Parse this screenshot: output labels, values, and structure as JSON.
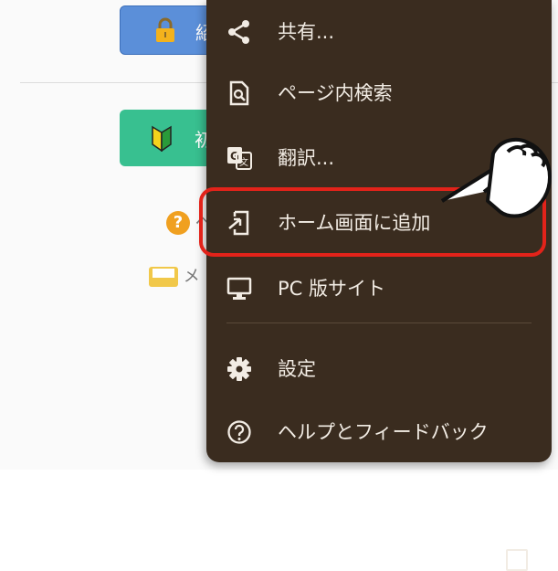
{
  "background": {
    "login_button_label": "紹",
    "beginner_button_label": "初",
    "help_link_text": "ヘ",
    "mail_link_text": "メ"
  },
  "menu": {
    "items": [
      {
        "label": "共有...",
        "icon": "share-icon"
      },
      {
        "label": "ページ内検索",
        "icon": "find-in-page-icon"
      },
      {
        "label": "翻訳...",
        "icon": "translate-icon"
      },
      {
        "label": "ホーム画面に追加",
        "icon": "add-to-home-screen-icon"
      },
      {
        "label": "PC 版サイト",
        "icon": "desktop-icon",
        "checked": false
      },
      {
        "label": "設定",
        "icon": "gear-icon"
      },
      {
        "label": "ヘルプとフィードバック",
        "icon": "help-icon"
      }
    ],
    "highlighted_item": "ホーム画面に追加"
  },
  "colors": {
    "menu_background": "#3a2c1f",
    "highlight_border": "#e2231a",
    "login_button": "#5b8fd9",
    "beginner_button": "#38c090"
  }
}
